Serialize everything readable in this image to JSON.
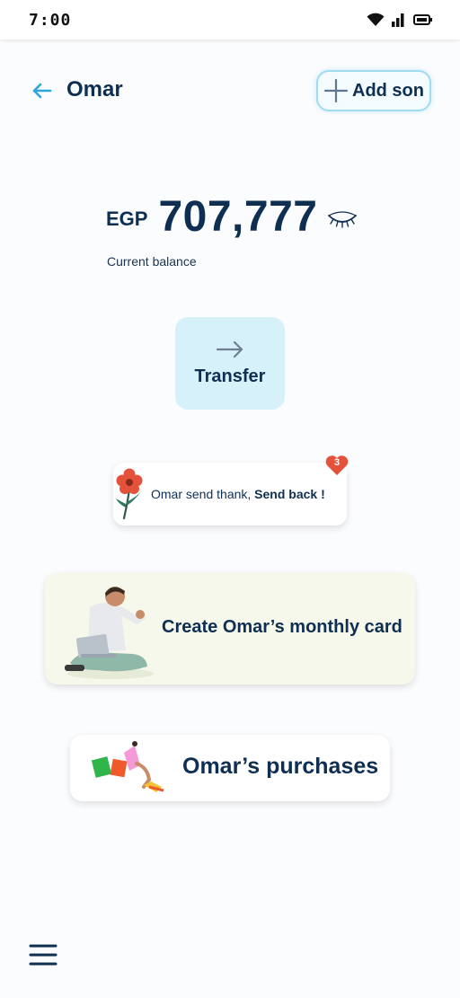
{
  "status_bar": {
    "time": "7:00",
    "icons": [
      "wifi-icon",
      "signal-icon",
      "battery-icon"
    ]
  },
  "header": {
    "title": "Omar",
    "back_icon": "arrow-left-icon",
    "add_son_label": "Add son",
    "add_son_icon": "plus-icon"
  },
  "balance": {
    "currency": "EGP",
    "amount": "707,777",
    "caption": "Current balance",
    "visibility_icon": "eye-closed-icon"
  },
  "transfer": {
    "label": "Transfer",
    "icon": "arrow-right-icon"
  },
  "thanks": {
    "text": "Omar send thank, ",
    "action": "Send back !",
    "badge_count": "3",
    "icon": "flower-icon"
  },
  "monthly_card": {
    "label": "Create Omar’s monthly card"
  },
  "purchases": {
    "label": "Omar’s purchases"
  },
  "bottom_nav": {
    "menu_icon": "hamburger-menu-icon"
  },
  "colors": {
    "primary_text": "#0f2f52",
    "accent_blue": "#2ca6dc",
    "transfer_bg": "#d7f1fb",
    "monthly_bg": "#f5f8ea",
    "badge_red": "#e4523b"
  }
}
